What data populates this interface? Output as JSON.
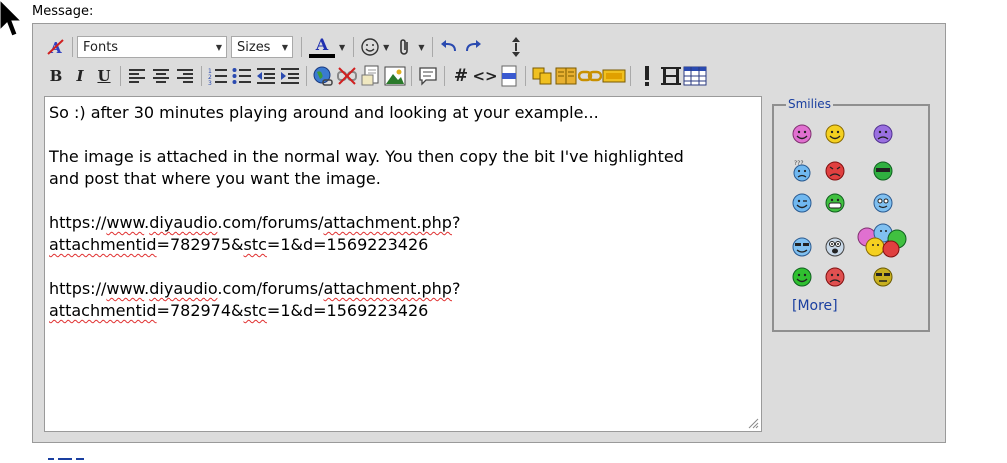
{
  "form": {
    "message_label": "Message:"
  },
  "toolbar": {
    "font_select": "Fonts",
    "size_select": "Sizes",
    "bold": "B",
    "italic": "I",
    "underline": "U",
    "font_color": "A",
    "hash": "#",
    "code": "<>",
    "php": "php"
  },
  "editor": {
    "lines": [
      "So :) after 30 minutes playing around and looking at your example...",
      "",
      "The image is attached in the normal way. You then copy the bit I've highlighted",
      "and post that where you want the image.",
      "",
      "https://www.diyaudio.com/forums/attachment.php?",
      "attachmentid=782975&stc=1&d=1569223426",
      "",
      "https://www.diyaudio.com/forums/attachment.php?",
      "attachmentid=782974&stc=1&d=1569223426"
    ],
    "link1": {
      "l1_scheme": "https://",
      "l1_www": "www",
      "l1_mid": ".",
      "l1_diy": "diyaudio",
      "l1_rest": ".com/forums/",
      "l1_att": "attachment.php",
      "l1_q": "?",
      "l2_id": "attachmentid",
      "l2_mid": "=782975&",
      "l2_stc": "stc",
      "l2_rest": "=1&d=1569223426"
    },
    "link2": {
      "l1_scheme": "https://",
      "l1_www": "www",
      "l1_mid": ".",
      "l1_diy": "diyaudio",
      "l1_rest": ".com/forums/",
      "l1_att": "attachment.php",
      "l1_q": "?",
      "l2_id": "attachmentid",
      "l2_mid": "=782974&",
      "l2_stc": "stc",
      "l2_rest": "=1&d=1569223426"
    }
  },
  "smilies": {
    "legend": "Smilies",
    "more_link": "[More]",
    "icons": [
      "smile-pink-icon",
      "smile-yellow-icon",
      "frown-purple-icon",
      "confused-blue-icon",
      "mad-red-icon",
      "eek-green-icon",
      "wink-blue-icon",
      "grin-green-icon",
      "cool-blue-icon",
      "sunglasses-blue-icon",
      "surprised-icon",
      "group-hug-icon",
      "smile-green-icon",
      "angry-red-icon",
      "shades-yellow-icon"
    ]
  },
  "colors": {
    "link": "#1a3fa0",
    "panel_bg": "#dcdcdc",
    "spellcheck": "#e03030"
  }
}
